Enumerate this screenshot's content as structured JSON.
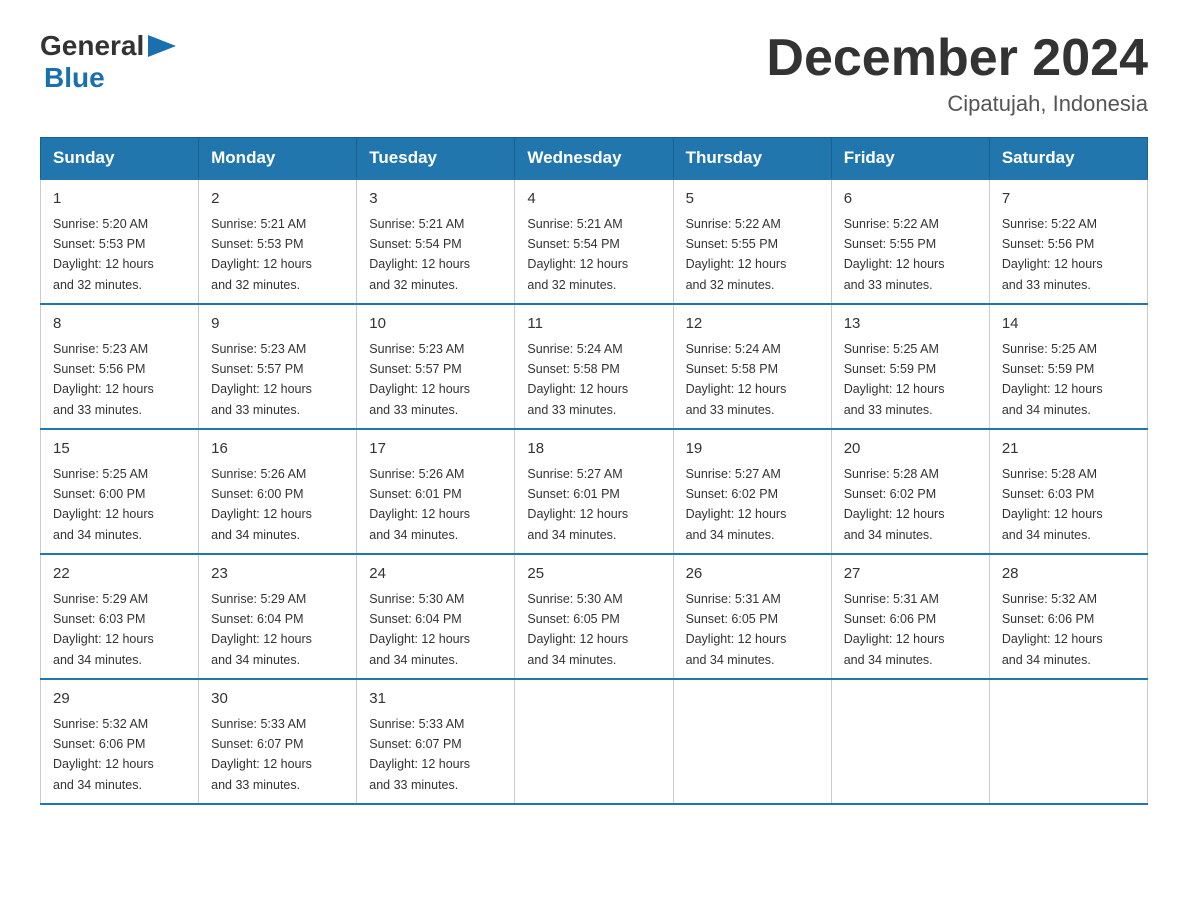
{
  "logo": {
    "text_general": "General",
    "text_blue": "Blue",
    "arrow": "▶"
  },
  "header": {
    "month_year": "December 2024",
    "location": "Cipatujah, Indonesia"
  },
  "days_of_week": [
    "Sunday",
    "Monday",
    "Tuesday",
    "Wednesday",
    "Thursday",
    "Friday",
    "Saturday"
  ],
  "weeks": [
    [
      {
        "day": "1",
        "sunrise": "5:20 AM",
        "sunset": "5:53 PM",
        "daylight": "12 hours and 32 minutes."
      },
      {
        "day": "2",
        "sunrise": "5:21 AM",
        "sunset": "5:53 PM",
        "daylight": "12 hours and 32 minutes."
      },
      {
        "day": "3",
        "sunrise": "5:21 AM",
        "sunset": "5:54 PM",
        "daylight": "12 hours and 32 minutes."
      },
      {
        "day": "4",
        "sunrise": "5:21 AM",
        "sunset": "5:54 PM",
        "daylight": "12 hours and 32 minutes."
      },
      {
        "day": "5",
        "sunrise": "5:22 AM",
        "sunset": "5:55 PM",
        "daylight": "12 hours and 32 minutes."
      },
      {
        "day": "6",
        "sunrise": "5:22 AM",
        "sunset": "5:55 PM",
        "daylight": "12 hours and 33 minutes."
      },
      {
        "day": "7",
        "sunrise": "5:22 AM",
        "sunset": "5:56 PM",
        "daylight": "12 hours and 33 minutes."
      }
    ],
    [
      {
        "day": "8",
        "sunrise": "5:23 AM",
        "sunset": "5:56 PM",
        "daylight": "12 hours and 33 minutes."
      },
      {
        "day": "9",
        "sunrise": "5:23 AM",
        "sunset": "5:57 PM",
        "daylight": "12 hours and 33 minutes."
      },
      {
        "day": "10",
        "sunrise": "5:23 AM",
        "sunset": "5:57 PM",
        "daylight": "12 hours and 33 minutes."
      },
      {
        "day": "11",
        "sunrise": "5:24 AM",
        "sunset": "5:58 PM",
        "daylight": "12 hours and 33 minutes."
      },
      {
        "day": "12",
        "sunrise": "5:24 AM",
        "sunset": "5:58 PM",
        "daylight": "12 hours and 33 minutes."
      },
      {
        "day": "13",
        "sunrise": "5:25 AM",
        "sunset": "5:59 PM",
        "daylight": "12 hours and 33 minutes."
      },
      {
        "day": "14",
        "sunrise": "5:25 AM",
        "sunset": "5:59 PM",
        "daylight": "12 hours and 34 minutes."
      }
    ],
    [
      {
        "day": "15",
        "sunrise": "5:25 AM",
        "sunset": "6:00 PM",
        "daylight": "12 hours and 34 minutes."
      },
      {
        "day": "16",
        "sunrise": "5:26 AM",
        "sunset": "6:00 PM",
        "daylight": "12 hours and 34 minutes."
      },
      {
        "day": "17",
        "sunrise": "5:26 AM",
        "sunset": "6:01 PM",
        "daylight": "12 hours and 34 minutes."
      },
      {
        "day": "18",
        "sunrise": "5:27 AM",
        "sunset": "6:01 PM",
        "daylight": "12 hours and 34 minutes."
      },
      {
        "day": "19",
        "sunrise": "5:27 AM",
        "sunset": "6:02 PM",
        "daylight": "12 hours and 34 minutes."
      },
      {
        "day": "20",
        "sunrise": "5:28 AM",
        "sunset": "6:02 PM",
        "daylight": "12 hours and 34 minutes."
      },
      {
        "day": "21",
        "sunrise": "5:28 AM",
        "sunset": "6:03 PM",
        "daylight": "12 hours and 34 minutes."
      }
    ],
    [
      {
        "day": "22",
        "sunrise": "5:29 AM",
        "sunset": "6:03 PM",
        "daylight": "12 hours and 34 minutes."
      },
      {
        "day": "23",
        "sunrise": "5:29 AM",
        "sunset": "6:04 PM",
        "daylight": "12 hours and 34 minutes."
      },
      {
        "day": "24",
        "sunrise": "5:30 AM",
        "sunset": "6:04 PM",
        "daylight": "12 hours and 34 minutes."
      },
      {
        "day": "25",
        "sunrise": "5:30 AM",
        "sunset": "6:05 PM",
        "daylight": "12 hours and 34 minutes."
      },
      {
        "day": "26",
        "sunrise": "5:31 AM",
        "sunset": "6:05 PM",
        "daylight": "12 hours and 34 minutes."
      },
      {
        "day": "27",
        "sunrise": "5:31 AM",
        "sunset": "6:06 PM",
        "daylight": "12 hours and 34 minutes."
      },
      {
        "day": "28",
        "sunrise": "5:32 AM",
        "sunset": "6:06 PM",
        "daylight": "12 hours and 34 minutes."
      }
    ],
    [
      {
        "day": "29",
        "sunrise": "5:32 AM",
        "sunset": "6:06 PM",
        "daylight": "12 hours and 34 minutes."
      },
      {
        "day": "30",
        "sunrise": "5:33 AM",
        "sunset": "6:07 PM",
        "daylight": "12 hours and 33 minutes."
      },
      {
        "day": "31",
        "sunrise": "5:33 AM",
        "sunset": "6:07 PM",
        "daylight": "12 hours and 33 minutes."
      },
      null,
      null,
      null,
      null
    ]
  ],
  "labels": {
    "sunrise": "Sunrise:",
    "sunset": "Sunset:",
    "daylight": "Daylight:"
  }
}
